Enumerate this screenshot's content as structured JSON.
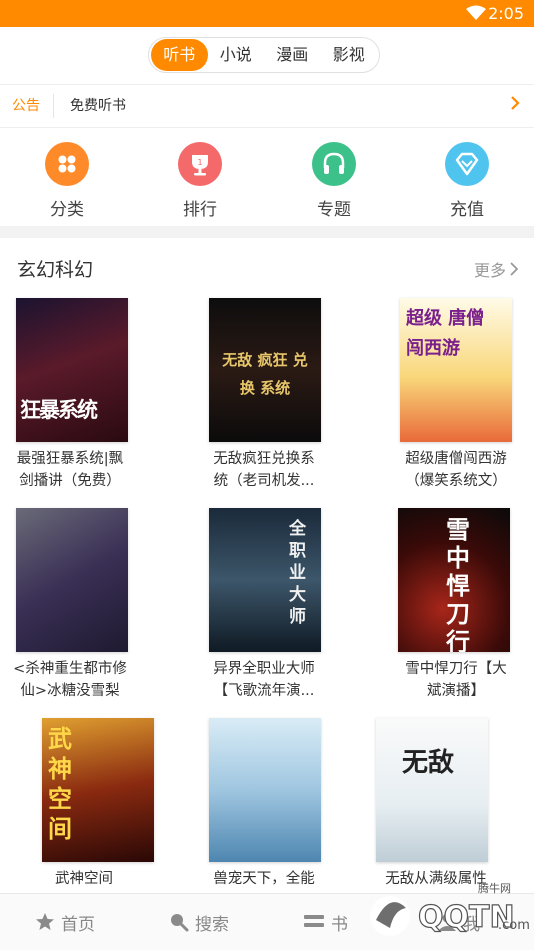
{
  "status": {
    "time": "2:05"
  },
  "top_tabs": [
    {
      "label": "听书",
      "active": true
    },
    {
      "label": "小说",
      "active": false
    },
    {
      "label": "漫画",
      "active": false
    },
    {
      "label": "影视",
      "active": false
    }
  ],
  "notice": {
    "tag": "公告",
    "text": "免费听书"
  },
  "quick_nav": [
    {
      "label": "分类",
      "color": "#ff8a2a",
      "icon": "grid-icon"
    },
    {
      "label": "排行",
      "color": "#f46a6a",
      "icon": "trophy-icon"
    },
    {
      "label": "专题",
      "color": "#3cc18a",
      "icon": "headphones-icon"
    },
    {
      "label": "充值",
      "color": "#4fc4ee",
      "icon": "diamond-icon"
    }
  ],
  "section": {
    "title": "玄幻科幻",
    "more": "更多",
    "books": [
      {
        "line1": "最强狂暴系统|飘",
        "line2": "剑播讲（免费）",
        "cover_text": "狂暴系统"
      },
      {
        "line1": "无敌疯狂兑换系",
        "line2": "统（老司机发...",
        "cover_text": "无敌 疯狂 兑换 系统"
      },
      {
        "line1": "超级唐僧闯西游",
        "line2": "（爆笑系统文）",
        "cover_text": "超级 唐僧 闯西游"
      },
      {
        "line1": "<杀神重生都市修",
        "line2": "仙>冰糖没雪梨",
        "cover_text": ""
      },
      {
        "line1": "异界全职业大师",
        "line2": "【飞歌流年演...",
        "cover_text": "全职业大师"
      },
      {
        "line1": "雪中悍刀行【大",
        "line2": "斌演播】",
        "cover_text": "雪中悍刀行"
      },
      {
        "line1": "武神空间",
        "line2": "",
        "cover_text": "武神空间"
      },
      {
        "line1": "兽宠天下，全能",
        "line2": "",
        "cover_text": ""
      },
      {
        "line1": "无敌从满级属性",
        "line2": "",
        "cover_text": "无敌"
      }
    ]
  },
  "bottom_tabs": [
    {
      "label": "首页",
      "icon": "star-icon"
    },
    {
      "label": "搜索",
      "icon": "search-icon"
    },
    {
      "label": "书",
      "icon": "shelf-icon"
    },
    {
      "label": "我",
      "icon": "user-icon"
    }
  ],
  "watermark": {
    "brand": "QQTN",
    "site": ".com",
    "label": "腾牛网"
  }
}
